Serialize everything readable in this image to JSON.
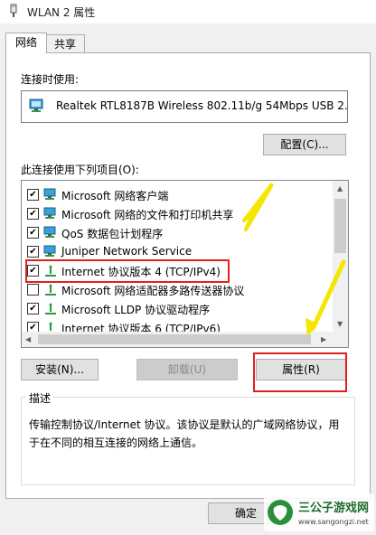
{
  "window": {
    "title": "WLAN 2 属性",
    "icon": "wifi-adapter-icon"
  },
  "tabs": [
    {
      "label": "网络",
      "active": true
    },
    {
      "label": "共享",
      "active": false
    }
  ],
  "connect_using": {
    "label": "连接时使用:",
    "adapter": "Realtek RTL8187B Wireless 802.11b/g 54Mbps USB 2.0",
    "configure_button": "配置(C)..."
  },
  "items": {
    "label": "此连接使用下列项目(O):",
    "list": [
      {
        "checked": true,
        "label": "Microsoft 网络客户端",
        "icon": "network-client-icon"
      },
      {
        "checked": true,
        "label": "Microsoft 网络的文件和打印机共享",
        "icon": "file-share-icon"
      },
      {
        "checked": true,
        "label": "QoS 数据包计划程序",
        "icon": "qos-icon"
      },
      {
        "checked": true,
        "label": "Juniper Network Service",
        "icon": "network-service-icon"
      },
      {
        "checked": true,
        "label": "Internet 协议版本 4 (TCP/IPv4)",
        "icon": "protocol-icon",
        "highlighted": true
      },
      {
        "checked": false,
        "label": "Microsoft 网络适配器多路传送器协议",
        "icon": "protocol-icon"
      },
      {
        "checked": true,
        "label": "Microsoft LLDP 协议驱动程序",
        "icon": "protocol-icon"
      },
      {
        "checked": true,
        "label": "Internet 协议版本 6 (TCP/IPv6)",
        "icon": "protocol-icon"
      }
    ]
  },
  "buttons": {
    "install": "安装(N)...",
    "uninstall": "卸载(U)",
    "properties": "属性(R)",
    "ok": "确定"
  },
  "description": {
    "title": "描述",
    "text": "传输控制协议/Internet 协议。该协议是默认的广域网络协议，用于在不同的相互连接的网络上通信。"
  },
  "watermark": {
    "brand": "三公子游戏网",
    "url": "www.sangongzi.net"
  },
  "colors": {
    "annotation_red": "#e02020",
    "annotation_yellow": "#f5e600"
  }
}
